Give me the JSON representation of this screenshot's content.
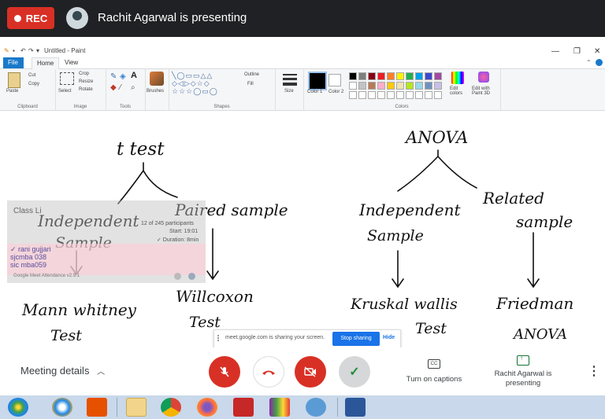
{
  "meet_header": {
    "rec_label": "REC",
    "presenter_title": "Rachit Agarwal is presenting"
  },
  "paint": {
    "window_title": "Untitled - Paint",
    "tabs": [
      "File",
      "Home",
      "View"
    ],
    "clipboard": {
      "paste": "Paste",
      "cut": "Cut",
      "copy": "Copy",
      "group": "Clipboard"
    },
    "image": {
      "select": "Select",
      "crop": "Crop",
      "resize": "Resize",
      "rotate": "Rotate",
      "group": "Image"
    },
    "tools": {
      "group": "Tools",
      "text_tool": "A"
    },
    "brushes": {
      "label": "Brushes"
    },
    "shapes": {
      "outline": "Outline",
      "fill": "Fill",
      "group": "Shapes"
    },
    "size": {
      "label": "Size"
    },
    "colors": {
      "color1": "Color 1",
      "color2": "Color 2",
      "edit_colors": "Edit colors",
      "edit_paint3d": "Edit with Paint 3D",
      "group": "Colors",
      "palette_row1": [
        "#000000",
        "#7f7f7f",
        "#880015",
        "#ed1c24",
        "#ff7f27",
        "#fff200",
        "#22b14c",
        "#00a2e8",
        "#3f48cc",
        "#a349a4"
      ],
      "palette_row2": [
        "#ffffff",
        "#c3c3c3",
        "#b97a57",
        "#ffaec9",
        "#ffc90e",
        "#efe4b0",
        "#b5e61d",
        "#99d9ea",
        "#7092be",
        "#c8bfe7"
      ]
    },
    "handwriting": {
      "left_title": "t test",
      "left_branch_1": "Independent",
      "left_branch_1b": "Sample",
      "left_branch_2": "Paired sample",
      "left_result_1": "Mann whitney",
      "left_result_1b": "Test",
      "left_result_2": "Willcoxon",
      "left_result_2b": "Test",
      "right_title": "ANOVA",
      "right_branch_1": "Independent",
      "right_branch_1b": "Sample",
      "right_branch_2": "Related",
      "right_branch_2b": "sample",
      "right_result_1": "Kruskal wallis",
      "right_result_1b": "Test",
      "right_result_2": "Friedman",
      "right_result_2b": "ANOVA"
    }
  },
  "attendance_overlay": {
    "title": "Class Li",
    "counter": "12 of 245 participants",
    "start": "Start: 19:01",
    "duration": "✓ Duration: 8min",
    "entries": [
      "✓ rani gujjari",
      "sjcmba 038",
      "sic mba059"
    ],
    "footer": "Google Meet Attendance v2.9.1"
  },
  "share_banner": {
    "message": "meet.google.com is sharing your screen.",
    "stop_label": "Stop sharing",
    "hide_label": "Hide"
  },
  "meet_bottom": {
    "meeting_details": "Meeting details",
    "captions_icon_text": "CC",
    "captions_label": "Turn on captions",
    "present_label": "Rachit Agarwal is presenting"
  },
  "colors": {
    "rec_red": "#d93025",
    "meet_dark": "#202124",
    "paint_blue": "#1979ca",
    "share_blue": "#1a73e8",
    "taskbar": "#c9d8ea"
  }
}
